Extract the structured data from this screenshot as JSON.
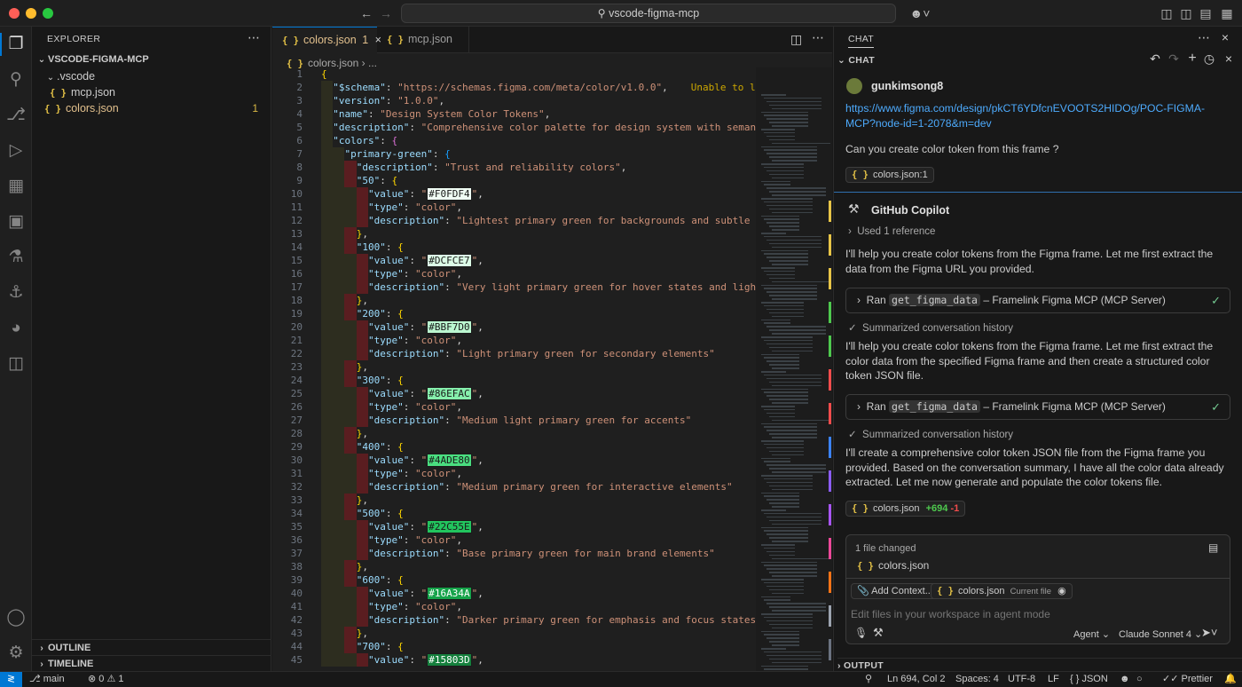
{
  "colors": {
    "accent": "#0078d4",
    "traffic_red": "#ff5f57",
    "traffic_yellow": "#febc2e",
    "traffic_green": "#28c840",
    "added": "#4ec94e",
    "removed": "#f14c4c"
  },
  "titlebar": {
    "command_center": "vscode-figma-mcp",
    "icons": [
      "back-arrow-icon",
      "forward-arrow-icon",
      "search-icon",
      "copilot-icon",
      "toggle-sidebar-icon",
      "toggle-panel-icon",
      "toggle-secondary-sidebar-icon",
      "customize-layout-icon"
    ]
  },
  "activitybar": {
    "items": [
      "explorer-icon",
      "search-icon",
      "source-control-icon",
      "run-debug-icon",
      "extensions-icon",
      "remote-explorer-icon",
      "testing-icon",
      "docker-icon",
      "gitlens-icon",
      "figma-icon"
    ],
    "bottom": [
      "accounts-icon",
      "manage-gear-icon"
    ]
  },
  "explorer": {
    "title": "EXPLORER",
    "folder": "VSCODE-FIGMA-MCP",
    "items": [
      {
        "name": ".vscode",
        "type": "folder"
      },
      {
        "name": "mcp.json",
        "type": "file"
      },
      {
        "name": "colors.json",
        "type": "file",
        "badge": "1"
      }
    ],
    "outline": "OUTLINE",
    "timeline": "TIMELINE"
  },
  "editor": {
    "tabs": [
      {
        "label": "colors.json",
        "badge": "1",
        "active": true
      },
      {
        "label": "mcp.json",
        "active": false
      }
    ],
    "breadcrumb": [
      "colors.json",
      "..."
    ],
    "warning": "Unable to load sche",
    "lines": [
      {
        "n": "1",
        "indent": "",
        "parts": [
          [
            "b1",
            "{"
          ]
        ]
      },
      {
        "n": "2",
        "indent": "  ",
        "parts": [
          [
            "key",
            "\"$schema\""
          ],
          [
            "pun",
            ": "
          ],
          [
            "str",
            "\"https://schemas.figma.com/meta/color/v1.0.0\""
          ],
          [
            "pun",
            ","
          ]
        ],
        "warn": true
      },
      {
        "n": "3",
        "indent": "  ",
        "parts": [
          [
            "key",
            "\"version\""
          ],
          [
            "pun",
            ": "
          ],
          [
            "str",
            "\"1.0.0\""
          ],
          [
            "pun",
            ","
          ]
        ]
      },
      {
        "n": "4",
        "indent": "  ",
        "parts": [
          [
            "key",
            "\"name\""
          ],
          [
            "pun",
            ": "
          ],
          [
            "str",
            "\"Design System Color Tokens\""
          ],
          [
            "pun",
            ","
          ]
        ]
      },
      {
        "n": "5",
        "indent": "  ",
        "parts": [
          [
            "key",
            "\"description\""
          ],
          [
            "pun",
            ": "
          ],
          [
            "str",
            "\"Comprehensive color palette for design system with semantic usag"
          ]
        ]
      },
      {
        "n": "6",
        "indent": "  ",
        "parts": [
          [
            "key",
            "\"colors\""
          ],
          [
            "pun",
            ": "
          ],
          [
            "b2",
            "{"
          ]
        ]
      },
      {
        "n": "7",
        "indent": "    ",
        "parts": [
          [
            "key",
            "\"primary-green\""
          ],
          [
            "pun",
            ": "
          ],
          [
            "b3",
            "{"
          ]
        ]
      },
      {
        "n": "8",
        "indent": "      ",
        "parts": [
          [
            "key",
            "\"description\""
          ],
          [
            "pun",
            ": "
          ],
          [
            "str",
            "\"Trust and reliability colors\""
          ],
          [
            "pun",
            ","
          ]
        ]
      },
      {
        "n": "9",
        "indent": "      ",
        "parts": [
          [
            "key",
            "\"50\""
          ],
          [
            "pun",
            ": "
          ],
          [
            "b1",
            "{"
          ]
        ]
      },
      {
        "n": "10",
        "indent": "        ",
        "parts": [
          [
            "key",
            "\"value\""
          ],
          [
            "pun",
            ": "
          ],
          [
            "str",
            "\""
          ],
          [
            "swatch",
            "#F0FDF4",
            "#F0FDF4",
            "#1a1a1a"
          ],
          [
            "str",
            "\""
          ],
          [
            "pun",
            ","
          ]
        ]
      },
      {
        "n": "11",
        "indent": "        ",
        "parts": [
          [
            "key",
            "\"type\""
          ],
          [
            "pun",
            ": "
          ],
          [
            "str",
            "\"color\""
          ],
          [
            "pun",
            ","
          ]
        ]
      },
      {
        "n": "12",
        "indent": "        ",
        "parts": [
          [
            "key",
            "\"description\""
          ],
          [
            "pun",
            ": "
          ],
          [
            "str",
            "\"Lightest primary green for backgrounds and subtle highlig"
          ]
        ]
      },
      {
        "n": "13",
        "indent": "      ",
        "parts": [
          [
            "b1",
            "}"
          ],
          [
            "pun",
            ","
          ]
        ]
      },
      {
        "n": "14",
        "indent": "      ",
        "parts": [
          [
            "key",
            "\"100\""
          ],
          [
            "pun",
            ": "
          ],
          [
            "b1",
            "{"
          ]
        ]
      },
      {
        "n": "15",
        "indent": "        ",
        "parts": [
          [
            "key",
            "\"value\""
          ],
          [
            "pun",
            ": "
          ],
          [
            "str",
            "\""
          ],
          [
            "swatch",
            "#DCFCE7",
            "#DCFCE7",
            "#1a1a1a"
          ],
          [
            "str",
            "\""
          ],
          [
            "pun",
            ","
          ]
        ]
      },
      {
        "n": "16",
        "indent": "        ",
        "parts": [
          [
            "key",
            "\"type\""
          ],
          [
            "pun",
            ": "
          ],
          [
            "str",
            "\"color\""
          ],
          [
            "pun",
            ","
          ]
        ]
      },
      {
        "n": "17",
        "indent": "        ",
        "parts": [
          [
            "key",
            "\"description\""
          ],
          [
            "pun",
            ": "
          ],
          [
            "str",
            "\"Very light primary green for hover states and light backg"
          ]
        ]
      },
      {
        "n": "18",
        "indent": "      ",
        "parts": [
          [
            "b1",
            "}"
          ],
          [
            "pun",
            ","
          ]
        ]
      },
      {
        "n": "19",
        "indent": "      ",
        "parts": [
          [
            "key",
            "\"200\""
          ],
          [
            "pun",
            ": "
          ],
          [
            "b1",
            "{"
          ]
        ]
      },
      {
        "n": "20",
        "indent": "        ",
        "parts": [
          [
            "key",
            "\"value\""
          ],
          [
            "pun",
            ": "
          ],
          [
            "str",
            "\""
          ],
          [
            "swatch",
            "#BBF7D0",
            "#BBF7D0",
            "#1a1a1a"
          ],
          [
            "str",
            "\""
          ],
          [
            "pun",
            ","
          ]
        ]
      },
      {
        "n": "21",
        "indent": "        ",
        "parts": [
          [
            "key",
            "\"type\""
          ],
          [
            "pun",
            ": "
          ],
          [
            "str",
            "\"color\""
          ],
          [
            "pun",
            ","
          ]
        ]
      },
      {
        "n": "22",
        "indent": "        ",
        "parts": [
          [
            "key",
            "\"description\""
          ],
          [
            "pun",
            ": "
          ],
          [
            "str",
            "\"Light primary green for secondary elements\""
          ]
        ]
      },
      {
        "n": "23",
        "indent": "      ",
        "parts": [
          [
            "b1",
            "}"
          ],
          [
            "pun",
            ","
          ]
        ]
      },
      {
        "n": "24",
        "indent": "      ",
        "parts": [
          [
            "key",
            "\"300\""
          ],
          [
            "pun",
            ": "
          ],
          [
            "b1",
            "{"
          ]
        ]
      },
      {
        "n": "25",
        "indent": "        ",
        "parts": [
          [
            "key",
            "\"value\""
          ],
          [
            "pun",
            ": "
          ],
          [
            "str",
            "\""
          ],
          [
            "swatch",
            "#86EFAC",
            "#86EFAC",
            "#1a1a1a"
          ],
          [
            "str",
            "\""
          ],
          [
            "pun",
            ","
          ]
        ]
      },
      {
        "n": "26",
        "indent": "        ",
        "parts": [
          [
            "key",
            "\"type\""
          ],
          [
            "pun",
            ": "
          ],
          [
            "str",
            "\"color\""
          ],
          [
            "pun",
            ","
          ]
        ]
      },
      {
        "n": "27",
        "indent": "        ",
        "parts": [
          [
            "key",
            "\"description\""
          ],
          [
            "pun",
            ": "
          ],
          [
            "str",
            "\"Medium light primary green for accents\""
          ]
        ]
      },
      {
        "n": "28",
        "indent": "      ",
        "parts": [
          [
            "b1",
            "}"
          ],
          [
            "pun",
            ","
          ]
        ]
      },
      {
        "n": "29",
        "indent": "      ",
        "parts": [
          [
            "key",
            "\"400\""
          ],
          [
            "pun",
            ": "
          ],
          [
            "b1",
            "{"
          ]
        ]
      },
      {
        "n": "30",
        "indent": "        ",
        "parts": [
          [
            "key",
            "\"value\""
          ],
          [
            "pun",
            ": "
          ],
          [
            "str",
            "\""
          ],
          [
            "swatch",
            "#4ADE80",
            "#4ADE80",
            "#1a1a1a"
          ],
          [
            "str",
            "\""
          ],
          [
            "pun",
            ","
          ]
        ]
      },
      {
        "n": "31",
        "indent": "        ",
        "parts": [
          [
            "key",
            "\"type\""
          ],
          [
            "pun",
            ": "
          ],
          [
            "str",
            "\"color\""
          ],
          [
            "pun",
            ","
          ]
        ]
      },
      {
        "n": "32",
        "indent": "        ",
        "parts": [
          [
            "key",
            "\"description\""
          ],
          [
            "pun",
            ": "
          ],
          [
            "str",
            "\"Medium primary green for interactive elements\""
          ]
        ]
      },
      {
        "n": "33",
        "indent": "      ",
        "parts": [
          [
            "b1",
            "}"
          ],
          [
            "pun",
            ","
          ]
        ]
      },
      {
        "n": "34",
        "indent": "      ",
        "parts": [
          [
            "key",
            "\"500\""
          ],
          [
            "pun",
            ": "
          ],
          [
            "b1",
            "{"
          ]
        ]
      },
      {
        "n": "35",
        "indent": "        ",
        "parts": [
          [
            "key",
            "\"value\""
          ],
          [
            "pun",
            ": "
          ],
          [
            "str",
            "\""
          ],
          [
            "swatch",
            "#22C55E",
            "#22C55E",
            "#1a1a1a"
          ],
          [
            "str",
            "\""
          ],
          [
            "pun",
            ","
          ]
        ]
      },
      {
        "n": "36",
        "indent": "        ",
        "parts": [
          [
            "key",
            "\"type\""
          ],
          [
            "pun",
            ": "
          ],
          [
            "str",
            "\"color\""
          ],
          [
            "pun",
            ","
          ]
        ]
      },
      {
        "n": "37",
        "indent": "        ",
        "parts": [
          [
            "key",
            "\"description\""
          ],
          [
            "pun",
            ": "
          ],
          [
            "str",
            "\"Base primary green for main brand elements\""
          ]
        ]
      },
      {
        "n": "38",
        "indent": "      ",
        "parts": [
          [
            "b1",
            "}"
          ],
          [
            "pun",
            ","
          ]
        ]
      },
      {
        "n": "39",
        "indent": "      ",
        "parts": [
          [
            "key",
            "\"600\""
          ],
          [
            "pun",
            ": "
          ],
          [
            "b1",
            "{"
          ]
        ]
      },
      {
        "n": "40",
        "indent": "        ",
        "parts": [
          [
            "key",
            "\"value\""
          ],
          [
            "pun",
            ": "
          ],
          [
            "str",
            "\""
          ],
          [
            "swatch",
            "#16A34A",
            "#16A34A",
            "#ffffff"
          ],
          [
            "str",
            "\""
          ],
          [
            "pun",
            ","
          ]
        ]
      },
      {
        "n": "41",
        "indent": "        ",
        "parts": [
          [
            "key",
            "\"type\""
          ],
          [
            "pun",
            ": "
          ],
          [
            "str",
            "\"color\""
          ],
          [
            "pun",
            ","
          ]
        ]
      },
      {
        "n": "42",
        "indent": "        ",
        "parts": [
          [
            "key",
            "\"description\""
          ],
          [
            "pun",
            ": "
          ],
          [
            "str",
            "\"Darker primary green for emphasis and focus states\""
          ]
        ]
      },
      {
        "n": "43",
        "indent": "      ",
        "parts": [
          [
            "b1",
            "}"
          ],
          [
            "pun",
            ","
          ]
        ]
      },
      {
        "n": "44",
        "indent": "      ",
        "parts": [
          [
            "key",
            "\"700\""
          ],
          [
            "pun",
            ": "
          ],
          [
            "b1",
            "{"
          ]
        ]
      },
      {
        "n": "45",
        "indent": "        ",
        "parts": [
          [
            "key",
            "\"value\""
          ],
          [
            "pun",
            ": "
          ],
          [
            "str",
            "\""
          ],
          [
            "swatch",
            "#15803D",
            "#15803D",
            "#ffffff"
          ],
          [
            "str",
            "\""
          ],
          [
            "pun",
            ","
          ]
        ]
      }
    ]
  },
  "chat": {
    "panel_title": "CHAT",
    "section_title": "CHAT",
    "user": {
      "name": "gunkimsong8",
      "link": "https://www.figma.com/design/pkCT6YDfcnEVOOTS2HIDOg/POC-FIGMA-MCP?node-id=1-2078&m=dev",
      "message": "Can you create color token from this frame ?",
      "attachment": "colors.json:1"
    },
    "copilot": {
      "name": "GitHub Copilot",
      "reference": "Used 1 reference",
      "p1": "I'll help you create color tokens from the Figma frame. Let me first extract the data from the Figma URL you provided.",
      "tool1": {
        "ran": "Ran",
        "tool": "get_figma_data",
        "server": "– Framelink Figma MCP (MCP Server)"
      },
      "summary1": "Summarized conversation history",
      "p2": "I'll help you create color tokens from the Figma frame. Let me first extract the color data from the specified Figma frame and then create a structured color token JSON file.",
      "tool2": {
        "ran": "Ran",
        "tool": "get_figma_data",
        "server": "– Framelink Figma MCP (MCP Server)"
      },
      "summary2": "Summarized conversation history",
      "p3": "I'll create a comprehensive color token JSON file from the Figma frame you provided. Based on the conversation summary, I have all the color data already extracted. Let me now generate and populate the color tokens file.",
      "file_chip": {
        "name": "colors.json",
        "added": "+694",
        "removed": "-1"
      }
    },
    "changes": {
      "count": "1 file changed",
      "file": "colors.json"
    },
    "input": {
      "add_context": "Add Context...",
      "context_file": "colors.json",
      "context_label": "Current file",
      "placeholder": "Edit files in your workspace in agent mode",
      "mode": "Agent",
      "model": "Claude Sonnet 4"
    },
    "output_label": "OUTPUT"
  },
  "statusbar": {
    "branch": "main",
    "errors": "0",
    "warnings": "1",
    "position": "Ln 694, Col 2",
    "spaces": "Spaces: 4",
    "encoding": "UTF-8",
    "eol": "LF",
    "language": "JSON",
    "formatter": "Prettier"
  }
}
